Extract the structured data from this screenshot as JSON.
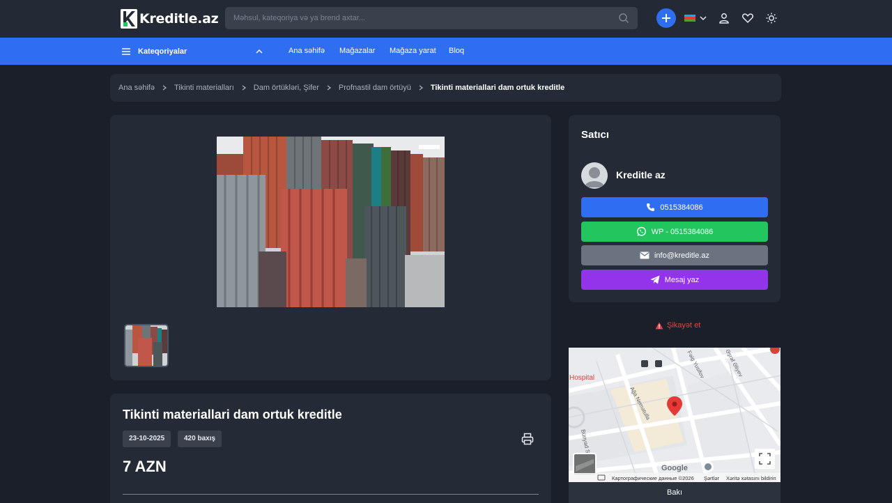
{
  "header": {
    "logo_text": "Kreditle.az",
    "search_placeholder": "Məhsul, kateqoriya və ya brend axtar..."
  },
  "nav": {
    "categories_label": "Kateqoriyalar",
    "links": [
      "Ana səhifə",
      "Mağazalar",
      "Mağaza yarat",
      "Bloq"
    ]
  },
  "breadcrumb": [
    "Ana səhifə",
    "Tikinti materialları",
    "Dam örtükləri, Şifer",
    "Profnastil dam örtüyü",
    "Tikinti materiallari dam ortuk kreditle"
  ],
  "product": {
    "title": "Tikinti materiallari dam ortuk kreditle",
    "date": "23-10-2025",
    "views": "420 baxış",
    "price": "7 AZN"
  },
  "seller": {
    "heading": "Satıcı",
    "name": "Kreditle az",
    "phone_label": "0515384086",
    "whatsapp_label": "WP - 0515384086",
    "email_label": "info@kreditle.az",
    "message_label": "Mesaj yaz"
  },
  "complaint_label": "Şikayət et",
  "map": {
    "hospital": "Hospital",
    "street_1": "Ağa Nemətulla",
    "street_2": "Fəig Yusifov",
    "street_3": "Əşrəf Əliyev",
    "street_4": "Bünyad Sərdarov",
    "google": "Google",
    "map_data": "Картографические данные ©2026",
    "terms": "Şərtlər",
    "report": "Xəritə xətasını bildirin",
    "city": "Bakı"
  },
  "colors": {
    "accent": "#2f6ef0",
    "whatsapp": "#22c55e",
    "email": "#6b7280",
    "message": "#9333ea",
    "danger": "#e04545"
  }
}
